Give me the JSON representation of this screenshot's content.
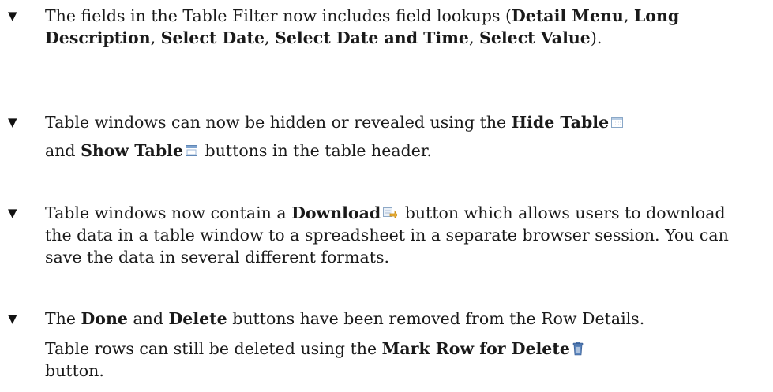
{
  "items": [
    {
      "p1": {
        "t0": "The fields in the Table Filter now includes field lookups (",
        "b0": "Detail Menu",
        "t1": ", ",
        "b1": "Long Description",
        "t2": ", ",
        "b2": "Select Date",
        "t3": ", ",
        "b3": "Select Date and Time",
        "t4": ", ",
        "b4": "Select Value",
        "t5": ")."
      }
    },
    {
      "p1": {
        "t0": "Table windows can now be hidden or revealed using the ",
        "b0": "Hide Table",
        "t1": "and ",
        "b1": "Show Table",
        "t2": " buttons in the table header."
      },
      "icons": [
        "hide-table-icon",
        "show-table-icon"
      ]
    },
    {
      "p1": {
        "t0": "Table windows now contain a ",
        "b0": "Download",
        "t1": " button which allows users to download the data in a table window to a spreadsheet in a separate browser session. You can save the data in several different formats."
      },
      "icons": [
        "download-icon"
      ]
    },
    {
      "p1": {
        "t0": "The ",
        "b0": "Done",
        "t1": " and ",
        "b1": "Delete",
        "t2": " buttons have been removed from the Row Details."
      },
      "p2": {
        "t0": "Table rows can still be deleted using the ",
        "b0": "Mark Row for Delete",
        "t1": " button."
      },
      "icons": [
        "trash-icon"
      ]
    }
  ],
  "bullet_glyph": "▼"
}
